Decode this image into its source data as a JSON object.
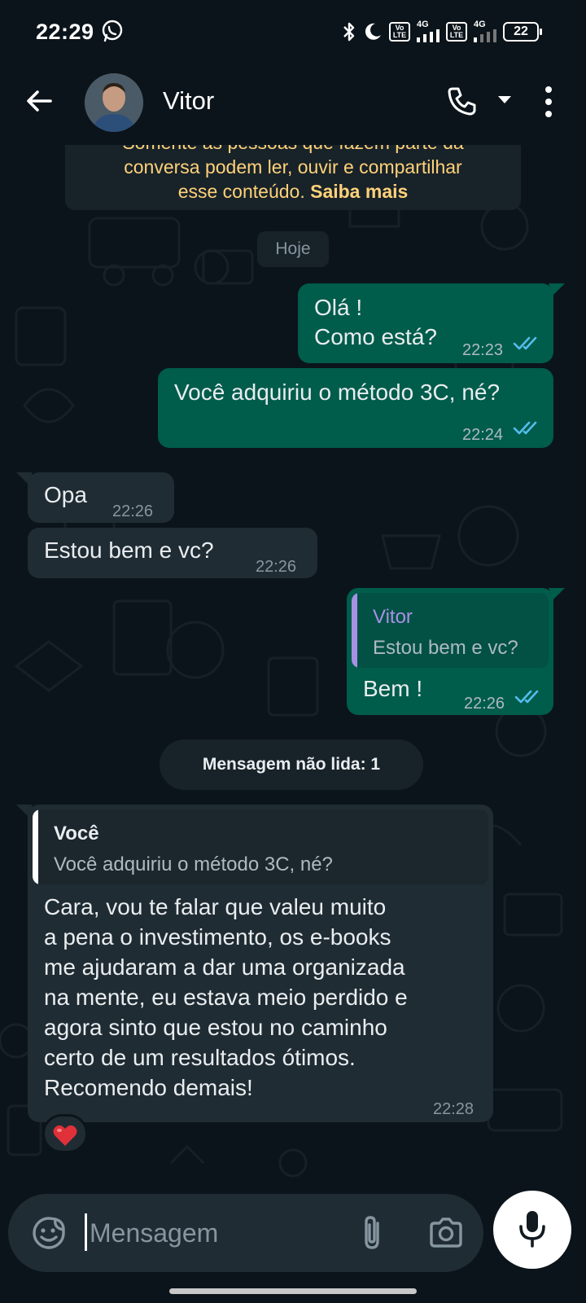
{
  "status_bar": {
    "time": "22:29",
    "battery": "22",
    "volte_label": "Vo LTE",
    "network": "4G",
    "icons": [
      "whatsapp-icon",
      "bluetooth-icon",
      "moon-icon",
      "volte-icon",
      "signal-icon",
      "battery-icon"
    ]
  },
  "header": {
    "contact_name": "Vitor",
    "icons": [
      "back-arrow-icon",
      "avatar",
      "phone-icon",
      "caret-down-icon",
      "more-vert-icon"
    ]
  },
  "encryption_notice": {
    "line1": "Somente as pessoas que fazem parte da",
    "line2": "conversa podem ler, ouvir e compartilhar",
    "line3": "esse conteúdo.",
    "link": "Saiba mais"
  },
  "day_label": "Hoje",
  "messages": [
    {
      "dir": "out",
      "lines": [
        "Olá !",
        "Como está?"
      ],
      "time": "22:23",
      "status": "read"
    },
    {
      "dir": "out",
      "lines": [
        "Você adquiriu o método 3C, né?"
      ],
      "time": "22:24",
      "status": "read"
    },
    {
      "dir": "in",
      "lines": [
        "Opa"
      ],
      "time": "22:26"
    },
    {
      "dir": "in",
      "lines": [
        "Estou bem e vc?"
      ],
      "time": "22:26"
    },
    {
      "dir": "out",
      "quote": {
        "name": "Vitor",
        "text": "Estou bem e vc?"
      },
      "lines": [
        "Bem !"
      ],
      "time": "22:26",
      "status": "read"
    }
  ],
  "unread_divider": "Mensagem não lida: 1",
  "last_message": {
    "quote": {
      "name": "Você",
      "text": "Você adquiriu o método 3C, né?"
    },
    "lines": [
      "Cara, vou te falar que valeu muito",
      "a pena o investimento, os e-books",
      "me ajudaram a dar uma organizada",
      "na mente, eu estava meio perdido e",
      "agora sinto que estou no caminho",
      "certo de um resultados ótimos.",
      "Recomendo demais!"
    ],
    "time": "22:28",
    "reaction": "❤️"
  },
  "composer": {
    "placeholder": "Mensagem"
  },
  "colors": {
    "background": "#0b141a",
    "outgoing_bubble": "#005c4b",
    "incoming_bubble": "#202c33",
    "read_ticks": "#53bdeb",
    "notice_text": "#ffd279",
    "quote_vitor": "#a791e4"
  }
}
